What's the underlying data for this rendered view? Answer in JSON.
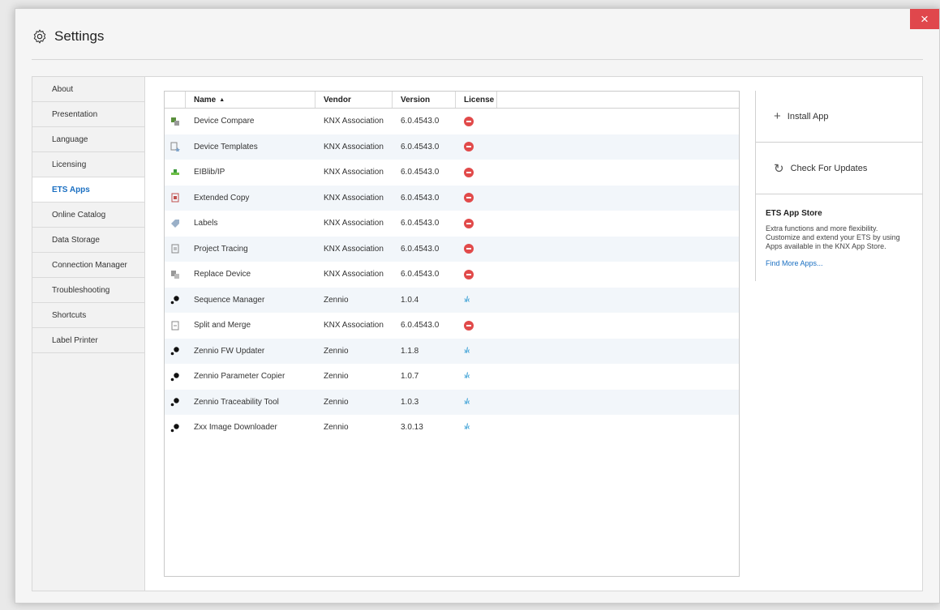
{
  "window": {
    "title": "Settings",
    "close_icon": "×"
  },
  "nav": {
    "items": [
      {
        "label": "About"
      },
      {
        "label": "Presentation"
      },
      {
        "label": "Language"
      },
      {
        "label": "Licensing"
      },
      {
        "label": "ETS Apps",
        "active": true
      },
      {
        "label": "Online Catalog"
      },
      {
        "label": "Data Storage"
      },
      {
        "label": "Connection Manager"
      },
      {
        "label": "Troubleshooting"
      },
      {
        "label": "Shortcuts"
      },
      {
        "label": "Label Printer"
      }
    ]
  },
  "table": {
    "headers": {
      "name": "Name",
      "vendor": "Vendor",
      "version": "Version",
      "license": "License"
    },
    "sort_indicator": "▲",
    "rows": [
      {
        "icon": "device-compare-icon",
        "name": "Device Compare",
        "vendor": "KNX Association",
        "version": "6.0.4543.0",
        "license": "unlicensed"
      },
      {
        "icon": "device-templates-icon",
        "name": "Device Templates",
        "vendor": "KNX Association",
        "version": "6.0.4543.0",
        "license": "unlicensed"
      },
      {
        "icon": "eiblib-ip-icon",
        "name": "EIBlib/IP",
        "vendor": "KNX Association",
        "version": "6.0.4543.0",
        "license": "unlicensed"
      },
      {
        "icon": "extended-copy-icon",
        "name": "Extended Copy",
        "vendor": "KNX Association",
        "version": "6.0.4543.0",
        "license": "unlicensed"
      },
      {
        "icon": "labels-icon",
        "name": "Labels",
        "vendor": "KNX Association",
        "version": "6.0.4543.0",
        "license": "unlicensed"
      },
      {
        "icon": "project-tracing-icon",
        "name": "Project Tracing",
        "vendor": "KNX Association",
        "version": "6.0.4543.0",
        "license": "unlicensed"
      },
      {
        "icon": "replace-device-icon",
        "name": "Replace Device",
        "vendor": "KNX Association",
        "version": "6.0.4543.0",
        "license": "unlicensed"
      },
      {
        "icon": "zennio-dots-icon",
        "name": "Sequence Manager",
        "vendor": "Zennio",
        "version": "1.0.4",
        "license": "zennio"
      },
      {
        "icon": "split-merge-icon",
        "name": "Split and Merge",
        "vendor": "KNX Association",
        "version": "6.0.4543.0",
        "license": "unlicensed"
      },
      {
        "icon": "zennio-dots-icon",
        "name": "Zennio FW Updater",
        "vendor": "Zennio",
        "version": "1.1.8",
        "license": "zennio"
      },
      {
        "icon": "zennio-dots-icon",
        "name": "Zennio Parameter Copier",
        "vendor": "Zennio",
        "version": "1.0.7",
        "license": "zennio"
      },
      {
        "icon": "zennio-dots-icon",
        "name": "Zennio Traceability Tool",
        "vendor": "Zennio",
        "version": "1.0.3",
        "license": "zennio"
      },
      {
        "icon": "zennio-dots-icon",
        "name": "Zxx Image Downloader",
        "vendor": "Zennio",
        "version": "3.0.13",
        "license": "zennio"
      }
    ]
  },
  "right_panel": {
    "install_label": "Install App",
    "install_icon": "+",
    "updates_label": "Check For Updates",
    "updates_icon": "↻",
    "store_title": "ETS App Store",
    "store_desc": "Extra functions and more flexibility. Customize and extend your ETS by using Apps available in the KNX App Store.",
    "store_link": "Find More Apps..."
  },
  "colors": {
    "accent": "#1a6fc2",
    "close": "#e0474c",
    "license_missing": "#e14a4a",
    "zennio": "#4aa7d8",
    "row_alt": "#f2f6fa"
  }
}
